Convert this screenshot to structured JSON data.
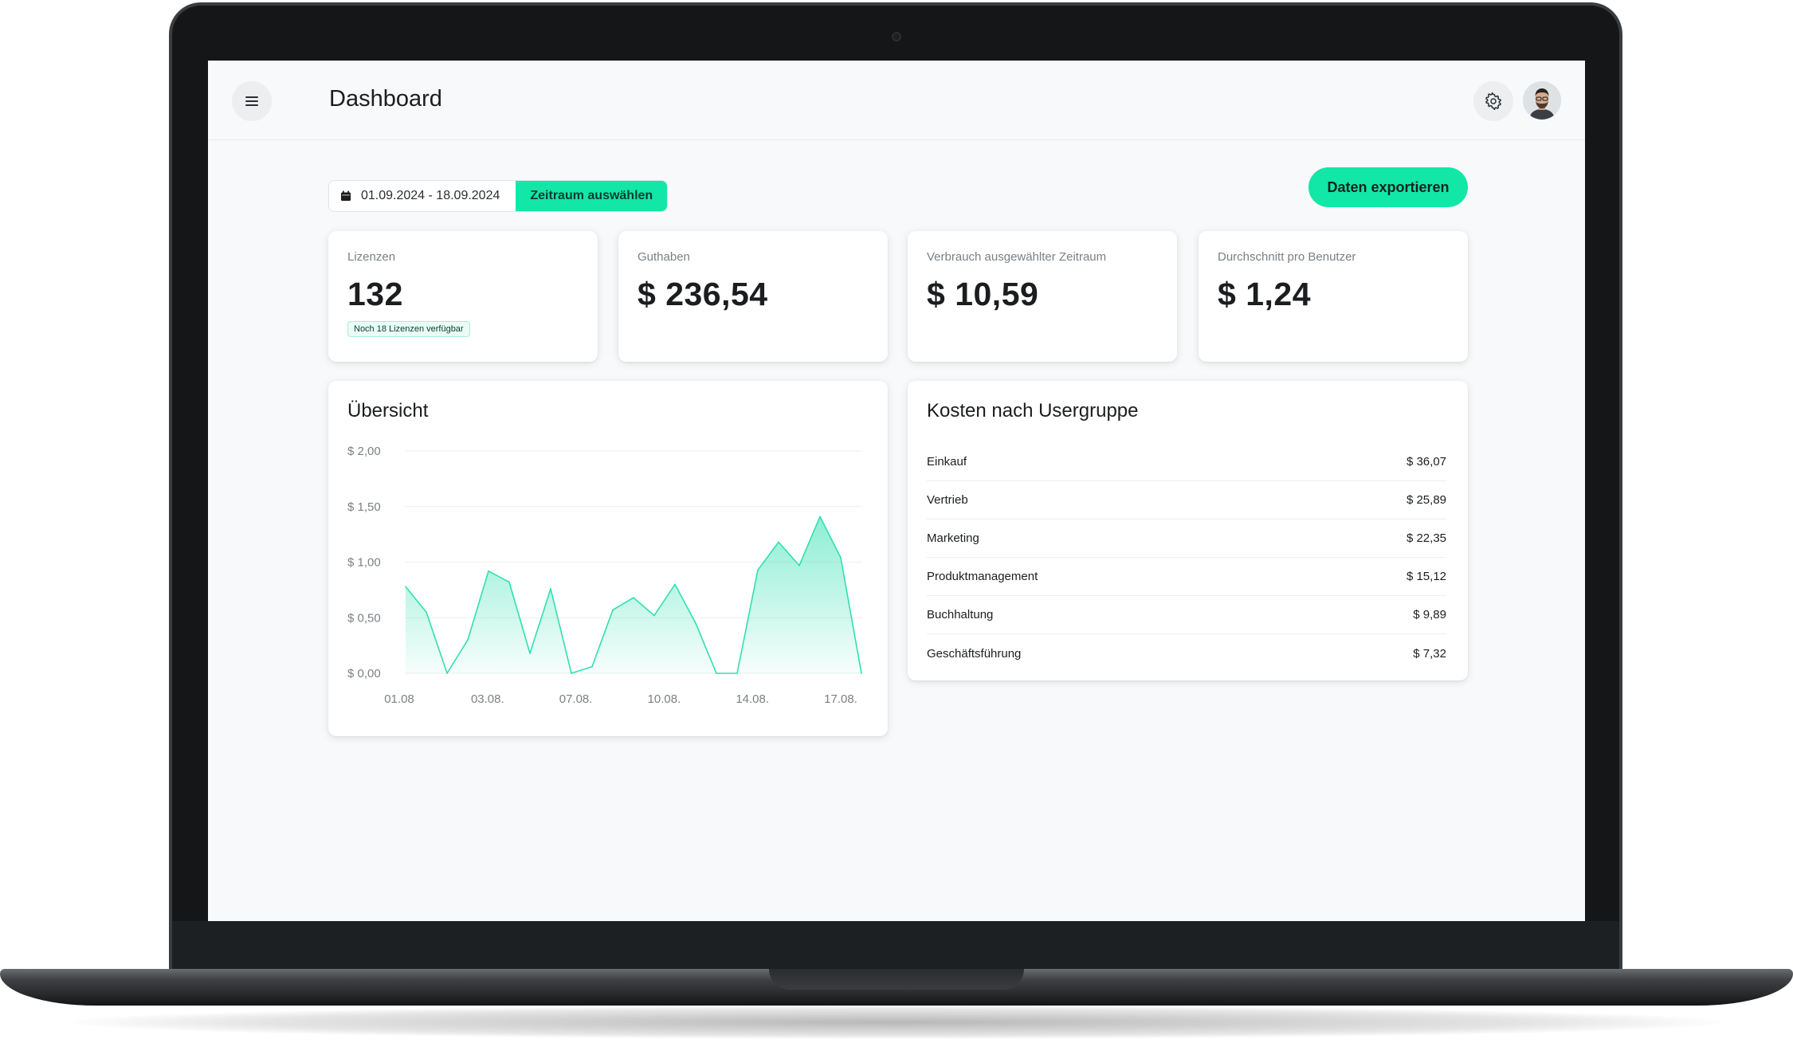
{
  "header": {
    "title": "Dashboard",
    "menu_icon": "menu-icon",
    "settings_icon": "gear-icon",
    "avatar": "user-avatar"
  },
  "filters": {
    "date_range": "01.09.2024 - 18.09.2024",
    "calendar_icon": "calendar-icon",
    "select_label": "Zeitraum auswählen",
    "export_label": "Daten exportieren"
  },
  "stats": [
    {
      "label": "Lizenzen",
      "value": "132",
      "badge": "Noch 18 Lizenzen verfügbar"
    },
    {
      "label": "Guthaben",
      "value": "$ 236,54"
    },
    {
      "label": "Verbrauch ausgewählter Zeitraum",
      "value": "$ 10,59"
    },
    {
      "label": "Durchschnitt pro Benutzer",
      "value": "$ 1,24"
    }
  ],
  "overview": {
    "title": "Übersicht"
  },
  "costs": {
    "title": "Kosten nach Usergruppe",
    "rows": [
      {
        "name": "Einkauf",
        "amount": "$ 36,07"
      },
      {
        "name": "Vertrieb",
        "amount": "$ 25,89"
      },
      {
        "name": "Marketing",
        "amount": "$ 22,35"
      },
      {
        "name": "Produktmanagement",
        "amount": "$ 15,12"
      },
      {
        "name": "Buchhaltung",
        "amount": "$ 9,89"
      },
      {
        "name": "Geschäftsführung",
        "amount": "$ 7,32"
      }
    ]
  },
  "colors": {
    "accent": "#12e7a8",
    "line": "#2fe0b0",
    "background": "#f8f9fa"
  },
  "chart_data": {
    "type": "area",
    "title": "Übersicht",
    "x_tick_labels": [
      "01.08",
      "03.08.",
      "07.08.",
      "10.08.",
      "14.08.",
      "17.08."
    ],
    "y_tick_labels": [
      "$ 2,00",
      "$ 1,50",
      "$ 1,00",
      "$ 0,50",
      "$ 0,00"
    ],
    "ylim": [
      0,
      2
    ],
    "grid": true,
    "series": [
      {
        "values": [
          0.78,
          0.55,
          0.0,
          0.3,
          0.92,
          0.82,
          0.18,
          0.76,
          0.0,
          0.06,
          0.57,
          0.68,
          0.52,
          0.8,
          0.45,
          0.0,
          0.0,
          0.93,
          1.18,
          0.97,
          1.41,
          1.04,
          0.0
        ]
      }
    ]
  }
}
